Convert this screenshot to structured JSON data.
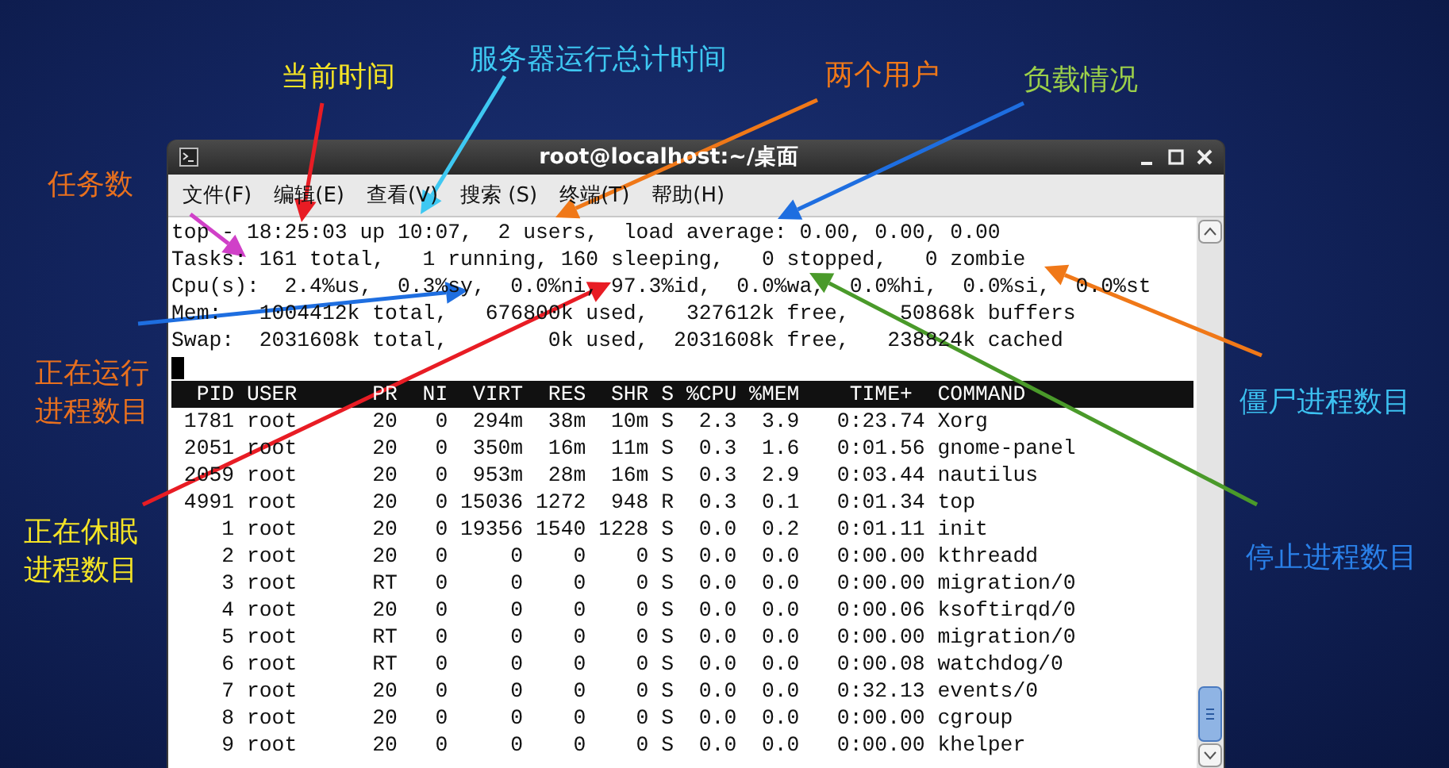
{
  "annotations": [
    {
      "text": "任务数",
      "color": "#e8701e",
      "arrow": {
        "color": "#d040c8"
      }
    },
    {
      "text": "当前时间",
      "color": "#f5e425",
      "arrow": {
        "color": "#e81c24"
      }
    },
    {
      "text": "服务器运行总计时间",
      "color": "#3ec8f2",
      "arrow": {
        "color": "#3ec8f2"
      }
    },
    {
      "text": "两个用户",
      "color": "#f07818",
      "arrow": {
        "color": "#f07818"
      }
    },
    {
      "text": "负载情况",
      "color": "#9cd04a",
      "arrow": {
        "color": "#1e6ee0"
      }
    },
    {
      "text": "正在运行进程数目",
      "color": "#e8701e",
      "arrow": {
        "color": "#1e6ee0"
      }
    },
    {
      "text": "正在休眠进程数目",
      "color": "#f5e425",
      "arrow": {
        "color": "#e81c24"
      }
    },
    {
      "text": "僵尸进程数目",
      "color": "#3cc0f0",
      "arrow": {
        "color": "#f07818"
      }
    },
    {
      "text": "停止进程数目",
      "color": "#2a80e8",
      "arrow": {
        "color": "#4a9a2a"
      }
    }
  ],
  "window": {
    "title": "root@localhost:~/桌面",
    "menu": [
      "文件(F)",
      "编辑(E)",
      "查看(V)",
      "搜索 (S)",
      "终端(T)",
      "帮助(H)"
    ]
  },
  "terminal": {
    "summary": [
      "top - 18:25:03 up 10:07,  2 users,  load average: 0.00, 0.00, 0.00",
      "Tasks: 161 total,   1 running, 160 sleeping,   0 stopped,   0 zombie",
      "Cpu(s):  2.4%us,  0.3%sy,  0.0%ni, 97.3%id,  0.0%wa,  0.0%hi,  0.0%si,  0.0%st",
      "Mem:   1004412k total,   676800k used,   327612k free,    50868k buffers",
      "Swap:  2031608k total,        0k used,  2031608k free,   238824k cached"
    ],
    "header": "  PID USER      PR  NI  VIRT  RES  SHR S %CPU %MEM    TIME+  COMMAND",
    "rows": [
      " 1781 root      20   0  294m  38m  10m S  2.3  3.9   0:23.74 Xorg",
      " 2051 root      20   0  350m  16m  11m S  0.3  1.6   0:01.56 gnome-panel",
      " 2059 root      20   0  953m  28m  16m S  0.3  2.9   0:03.44 nautilus",
      " 4991 root      20   0 15036 1272  948 R  0.3  0.1   0:01.34 top",
      "    1 root      20   0 19356 1540 1228 S  0.0  0.2   0:01.11 init",
      "    2 root      20   0     0    0    0 S  0.0  0.0   0:00.00 kthreadd",
      "    3 root      RT   0     0    0    0 S  0.0  0.0   0:00.00 migration/0",
      "    4 root      20   0     0    0    0 S  0.0  0.0   0:00.06 ksoftirqd/0",
      "    5 root      RT   0     0    0    0 S  0.0  0.0   0:00.00 migration/0",
      "    6 root      RT   0     0    0    0 S  0.0  0.0   0:00.08 watchdog/0",
      "    7 root      20   0     0    0    0 S  0.0  0.0   0:32.13 events/0",
      "    8 root      20   0     0    0    0 S  0.0  0.0   0:00.00 cgroup",
      "    9 root      20   0     0    0    0 S  0.0  0.0   0:00.00 khelper"
    ]
  }
}
